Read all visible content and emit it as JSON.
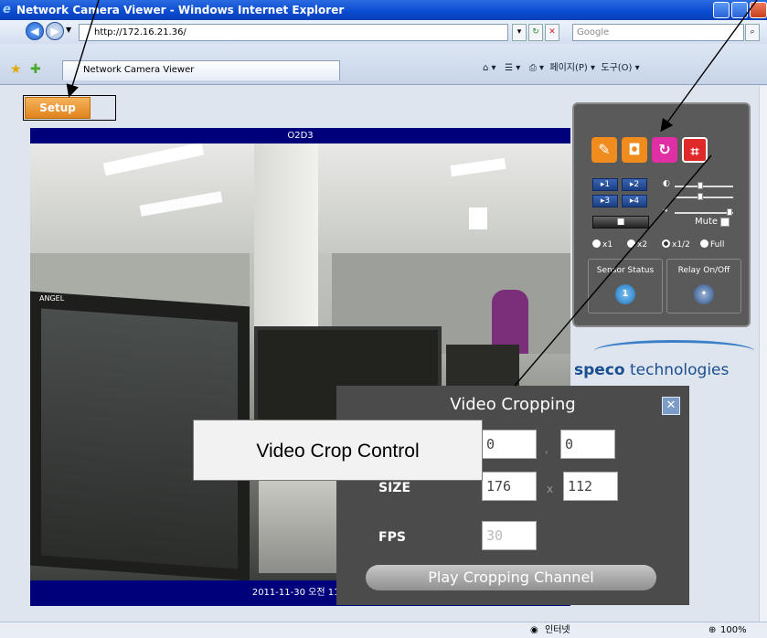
{
  "window": {
    "title": "Network Camera Viewer - Windows Internet Explorer"
  },
  "address_bar": {
    "url": "http://172.16.21.36/",
    "search_placeholder": "Google"
  },
  "tab": {
    "label": "Network Camera Viewer"
  },
  "command_bar": {
    "page_label": "페이지(P)",
    "tools_label": "도구(O)"
  },
  "page": {
    "setup_label": "Setup",
    "video": {
      "header": "O2D3",
      "timestamp": "2011-11-30 오전 11:3",
      "monitor_label": "ANGEL"
    },
    "control_panel": {
      "channels": [
        "1",
        "2",
        "3",
        "4"
      ],
      "mute_label": "Mute",
      "zoom_options": [
        "x1",
        "x2",
        "x1/2",
        "Full"
      ],
      "sensor_status_label": "Sensor Status",
      "sensor_value": "1",
      "relay_label": "Relay On/Off"
    },
    "logo": {
      "brand": "speco",
      "suffix": " technologies"
    }
  },
  "crop_dialog": {
    "title": "Video Cropping",
    "position": [
      "0",
      "0"
    ],
    "separator_pos": ",",
    "size_label": "SIZE",
    "size": [
      "176",
      "112"
    ],
    "separator_size": "x",
    "fps_label": "FPS",
    "fps": "30",
    "play_button": "Play Cropping Channel"
  },
  "callout": "Video Crop Control",
  "status_bar": {
    "zone": "인터넷",
    "zoom": "100%"
  }
}
